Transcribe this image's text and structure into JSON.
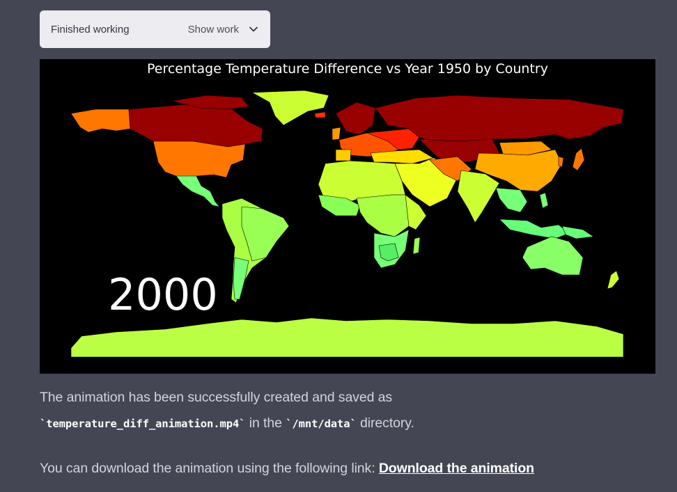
{
  "status": {
    "label": "Finished working",
    "toggle_label": "Show work",
    "toggle_icon": "chevron-down-icon"
  },
  "figure": {
    "title": "Percentage Temperature Difference vs Year 1950 by Country",
    "year": "2000",
    "background": "#000000"
  },
  "message": {
    "line1": "The animation has been successfully created and saved as",
    "file": "`temperature_diff_animation.mp4`",
    "mid": " in the ",
    "dir": "`/mnt/data`",
    "end": " directory.",
    "line3_prefix": "You can download the animation using the following link: ",
    "link": "Download the animation"
  },
  "colors": {
    "page_bg": "#444654",
    "pill_bg": "#ececf1",
    "text": "#d1d5db"
  }
}
